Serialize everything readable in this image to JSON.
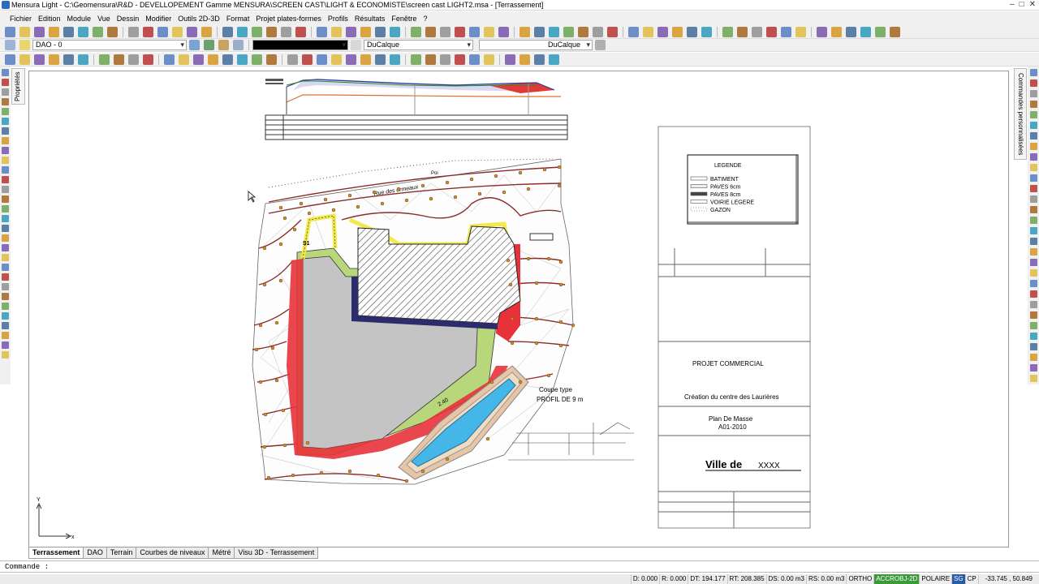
{
  "window": {
    "title": "Mensura Light - C:\\Geomensura\\R&D - DEVELLOPEMENT Gamme MENSURA\\SCREEN CAST\\LIGHT & ECONOMISTE\\screen cast LIGHT2.msa - [Terrassement]"
  },
  "menu": [
    "Fichier",
    "Edition",
    "Module",
    "Vue",
    "Dessin",
    "Modifier",
    "Outils 2D-3D",
    "Format",
    "Projet plates-formes",
    "Profils",
    "Résultats",
    "Fenêtre",
    "?"
  ],
  "layer_toolbar": {
    "layer_name": "DAO - 0",
    "color_value": "DuCalque",
    "linetype_value": "DuCalque"
  },
  "side_tabs": {
    "left": "Propriétés",
    "right": "Commandes personnalisées"
  },
  "drawing": {
    "road_label": "Rue des ormeaux",
    "poi_label": "Poi",
    "section_note_line1": "Coupe type",
    "section_note_line2": "PROFIL DE 9 m",
    "legend_title": "LEGENDE",
    "legend_items": [
      "BATIMENT",
      "PAVES 6cm",
      "PAVES 8cm",
      "VOIRIE LEGERE",
      "GAZON"
    ],
    "cartouche_project": "PROJET COMMERCIAL",
    "cartouche_subject": "Création du centre des Laurières",
    "cartouche_plan": "Plan De Masse",
    "cartouche_ref": "A01-2010",
    "cartouche_city": "Ville de",
    "cartouche_city_name": "XXXX",
    "ucs_x": "x",
    "ucs_y": "Y"
  },
  "layout_tabs": [
    "Terrassement",
    "DAO",
    "Terrain",
    "Courbes de niveaux",
    "Métré",
    "Visu 3D - Terrassement"
  ],
  "command_prompt": "Commande :",
  "status": {
    "d": "D: 0.000",
    "r": "R: 0.000",
    "dt": "DT: 194.177",
    "rt": "RT: 208.385",
    "ds": "DS: 0.00 m3",
    "rs": "RS: 0.00 m3",
    "ortho": "ORTHO",
    "accrobj": "ACCROBJ-2D",
    "polaire": "POLAIRE",
    "sg": "SG",
    "cp": "CP",
    "coords": "-33.745 , 50.849"
  },
  "colors": {
    "accent": "#3a9a3a",
    "warn": "#c03030",
    "building_hatch": "#333333",
    "green_area": "#b7d77a",
    "paving": "#f2ea4a",
    "slope": "#e8323a"
  }
}
